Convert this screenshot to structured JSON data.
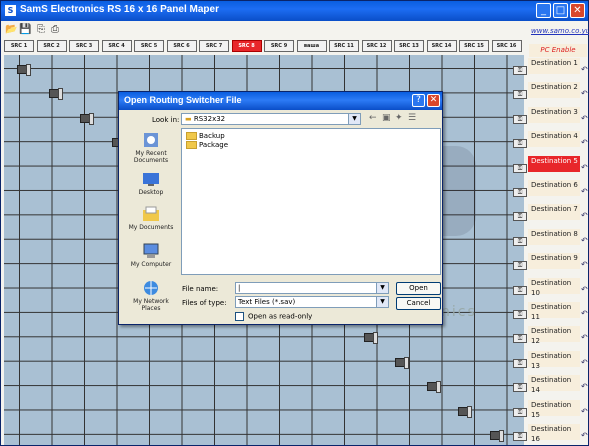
{
  "window": {
    "title": "SamS Electronics RS 16 x 16 Panel Maper",
    "app_icon": "S"
  },
  "toolbar": {
    "icons": [
      "open-icon",
      "save-icon",
      "copy-icon",
      "print-icon"
    ],
    "website": "www.samo.co.yu"
  },
  "sources": [
    "SRC 1",
    "SRC 2",
    "SRC 3",
    "SRC 4",
    "SRC 5",
    "SRC 6",
    "SRC 7",
    "SRC 8",
    "SRC 9",
    "ваша",
    "SRC 11",
    "SRC 12",
    "SRC 13",
    "SRC 14",
    "SRC 15",
    "SRC 16"
  ],
  "active_source_index": 7,
  "pc_enable": "PC Enable",
  "destinations": [
    "Destination 1",
    "Destination 2",
    "Destination 3",
    "Destination 4",
    "Destination 5",
    "Destination 6",
    "Destination 7",
    "Destination 8",
    "Destination 9",
    "Destination 10",
    "Destination 11",
    "Destination 12",
    "Destination 13",
    "Destination 14",
    "Destination 15",
    "Destination 16"
  ],
  "active_destination_index": 4,
  "colors": {
    "active": "#e8262a",
    "grid_bg": "#a9c0d3",
    "titlebar": "#0a5ee0"
  },
  "dialog": {
    "title": "Open Routing Switcher File",
    "look_in_label": "Look in:",
    "look_in_value": "RS32x32",
    "places": [
      "My Recent Documents",
      "Desktop",
      "My Documents",
      "My Computer",
      "My Network Places"
    ],
    "files": [
      "Backup",
      "Package"
    ],
    "file_name_label": "File name:",
    "file_name_value": "|",
    "file_type_label": "Files of type:",
    "file_type_value": "Text Files (*.sav)",
    "read_only_label": "Open as read-only",
    "open_label": "Open",
    "cancel_label": "Cancel"
  }
}
